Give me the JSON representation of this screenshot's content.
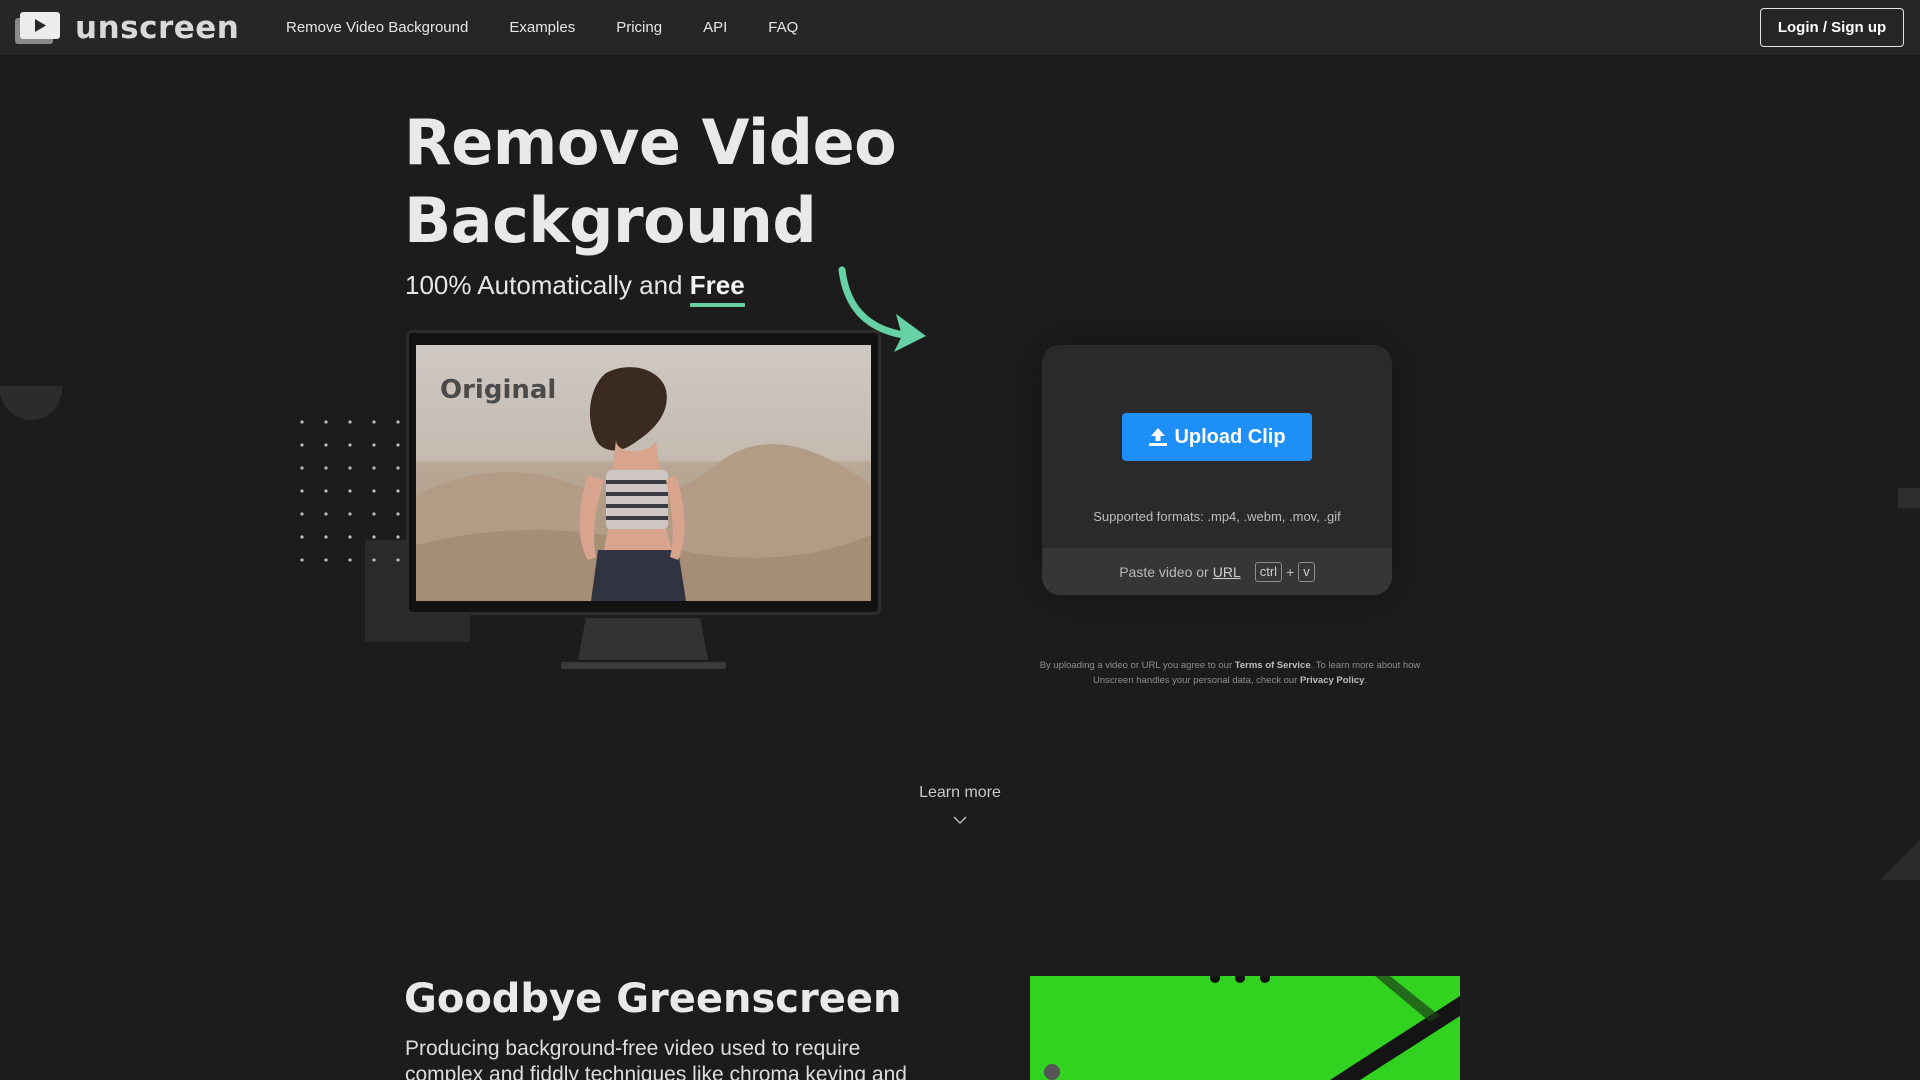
{
  "nav": {
    "brand": "unscreen",
    "links": [
      "Remove Video Background",
      "Examples",
      "Pricing",
      "API",
      "FAQ"
    ],
    "login_label": "Login / Sign up"
  },
  "hero": {
    "title_line1": "Remove Video",
    "title_line2": "Background",
    "subtitle_prefix": "100% Automatically and ",
    "subtitle_emphasis": "Free",
    "monitor_label": "Original"
  },
  "upload": {
    "button_label": "Upload Clip",
    "formats": "Supported formats: .mp4, .webm, .mov, .gif",
    "paste_prefix": "Paste video or",
    "paste_link": "URL",
    "key_ctrl": "ctrl",
    "key_plus": "+",
    "key_v": "v"
  },
  "terms": {
    "part1": "By uploading a video or URL you agree to our ",
    "tos": "Terms of Service",
    "part2": ". To learn more about how Unscreen handles your personal data, check our ",
    "privacy": "Privacy Policy",
    "part3": "."
  },
  "learn_more": "Learn more",
  "greenscreen": {
    "title": "Goodbye Greenscreen",
    "text": "Producing background-free video used to require complex and fiddly techniques like chroma keying and"
  },
  "colors": {
    "accent_green": "#66d1a4",
    "upload_blue": "#1e8ff7",
    "background": "#1c1c1c",
    "nav_background": "#262626"
  },
  "icons": [
    "unscreen-logo-icon",
    "upload-icon",
    "chevron-down-icon",
    "curved-arrow-icon"
  ]
}
